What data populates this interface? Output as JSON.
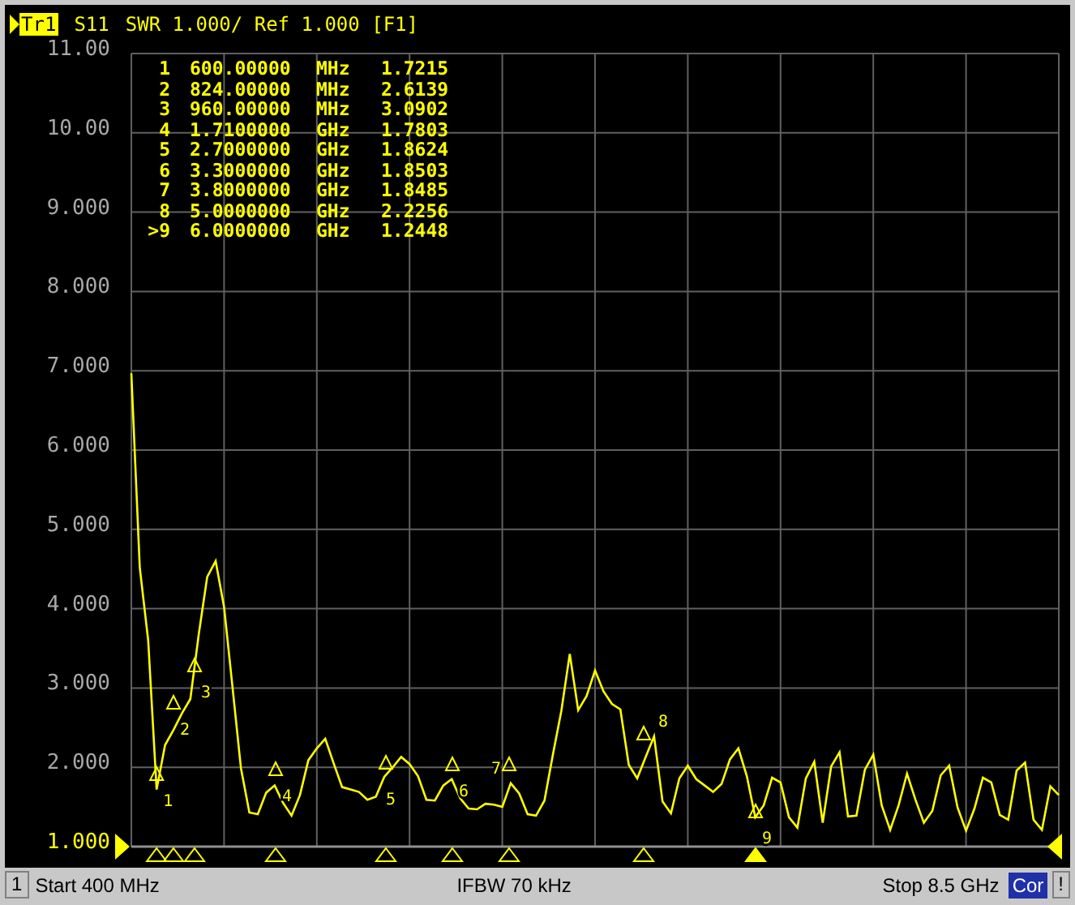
{
  "header": {
    "trace": "Tr1",
    "selected": true,
    "description": "SWR 1.000/ Ref 1.000 [F1]"
  },
  "chart_data": {
    "type": "line",
    "ylim": [
      1,
      11
    ],
    "grid": true,
    "yticks": [
      {
        "value": 11,
        "label": "11.00"
      },
      {
        "value": 10,
        "label": "10.00"
      },
      {
        "value": 9,
        "label": "9.000"
      },
      {
        "value": 8,
        "label": "8.000"
      },
      {
        "value": 7,
        "label": "7.000"
      },
      {
        "value": 6,
        "label": "6.000"
      },
      {
        "value": 5,
        "label": "5.000"
      },
      {
        "value": 4,
        "label": "4.000"
      },
      {
        "value": 3,
        "label": "3.000"
      },
      {
        "value": 2,
        "label": "2.000"
      },
      {
        "value": 1,
        "label": "1.000"
      }
    ],
    "ref_lines": [
      {
        "axis": "y",
        "value": 1
      }
    ],
    "categories": [
      null,
      null,
      null,
      null,
      null,
      null,
      null,
      null,
      null,
      null,
      null,
      null,
      null,
      null,
      null,
      null,
      null,
      null,
      null,
      null,
      null,
      null,
      null,
      null,
      null,
      null,
      null,
      null,
      null,
      null,
      null,
      null,
      null,
      null,
      null,
      null,
      null,
      null,
      null,
      null,
      null,
      null,
      null,
      null,
      null,
      null,
      null,
      null,
      null,
      null,
      null,
      null,
      null,
      null,
      null,
      null,
      null,
      null,
      null,
      null,
      null,
      null,
      null,
      null,
      null,
      null,
      null,
      null,
      null,
      null,
      null,
      null,
      null,
      null,
      null,
      null,
      null,
      null,
      null,
      null,
      null,
      null,
      null,
      null,
      null,
      null,
      null,
      null,
      null,
      null,
      null,
      null,
      null,
      null,
      null,
      null,
      null,
      null,
      null,
      null,
      null,
      null,
      null,
      null,
      null,
      null,
      null,
      null,
      null,
      null,
      null
    ],
    "series": [
      {
        "name": "S11",
        "color": "#ffff00",
        "values": [
          6.97,
          4.52,
          3.6,
          1.72,
          2.28,
          2.47,
          2.68,
          2.86,
          3.68,
          4.4,
          4.6,
          4.02,
          3.01,
          1.99,
          1.43,
          1.41,
          1.68,
          1.77,
          1.55,
          1.39,
          1.65,
          2.09,
          2.24,
          2.36,
          2.05,
          1.75,
          1.72,
          1.69,
          1.59,
          1.63,
          1.88,
          2.0,
          2.13,
          2.04,
          1.89,
          1.59,
          1.58,
          1.77,
          1.85,
          1.61,
          1.48,
          1.47,
          1.54,
          1.53,
          1.5,
          1.8,
          1.67,
          1.41,
          1.39,
          1.58,
          2.16,
          2.71,
          3.43,
          2.72,
          2.9,
          3.22,
          2.96,
          2.8,
          2.73,
          2.03,
          1.86,
          2.13,
          2.39,
          1.57,
          1.42,
          1.86,
          2.02,
          1.85,
          1.77,
          1.69,
          1.79,
          2.1,
          2.24,
          1.89,
          1.37,
          1.52,
          1.87,
          1.81,
          1.37,
          1.24,
          1.86,
          2.07,
          1.3,
          2.01,
          2.19,
          1.38,
          1.39,
          1.97,
          2.16,
          1.52,
          1.21,
          1.52,
          1.92,
          1.59,
          1.3,
          1.45,
          1.9,
          2.02,
          1.49,
          1.2,
          1.48,
          1.87,
          1.81,
          1.4,
          1.34,
          1.96,
          2.06,
          1.34,
          1.21,
          1.76,
          1.65
        ]
      }
    ]
  },
  "markers": [
    {
      "label": "1",
      "frequency": "600.00000",
      "unit": "MHz",
      "value": "1.7215",
      "trace_label": "1",
      "selected": false
    },
    {
      "label": "2",
      "frequency": "824.00000",
      "unit": "MHz",
      "value": "2.6139",
      "trace_label": "2",
      "selected": false
    },
    {
      "label": "3",
      "frequency": "960.00000",
      "unit": "MHz",
      "value": "3.0902",
      "trace_label": "3",
      "selected": false
    },
    {
      "label": "4",
      "frequency": "1.7100000",
      "unit": "GHz",
      "value": "1.7803",
      "trace_label": "4",
      "selected": false
    },
    {
      "label": "5",
      "frequency": "2.7000000",
      "unit": "GHz",
      "value": "1.8624",
      "trace_label": "5",
      "selected": false
    },
    {
      "label": "6",
      "frequency": "3.3000000",
      "unit": "GHz",
      "value": "1.8503",
      "trace_label": "6",
      "selected": false
    },
    {
      "label": "7",
      "frequency": "3.8000000",
      "unit": "GHz",
      "value": "1.8485",
      "trace_label": "7",
      "selected": false
    },
    {
      "label": "8",
      "frequency": "5.0000000",
      "unit": "GHz",
      "value": "2.2256",
      "trace_label": "8",
      "selected": false
    },
    {
      "label": ">9",
      "frequency": "6.0000000",
      "unit": "GHz",
      "value": "1.2448",
      "trace_label": "9",
      "selected": true
    }
  ],
  "status_bar": {
    "channel": "1",
    "start": "Start 400 MHz",
    "ifbw": "IFBW 70 kHz",
    "stop": "Stop 8.5 GHz",
    "correction": "Cor",
    "correction_on": true,
    "warning": "!"
  }
}
